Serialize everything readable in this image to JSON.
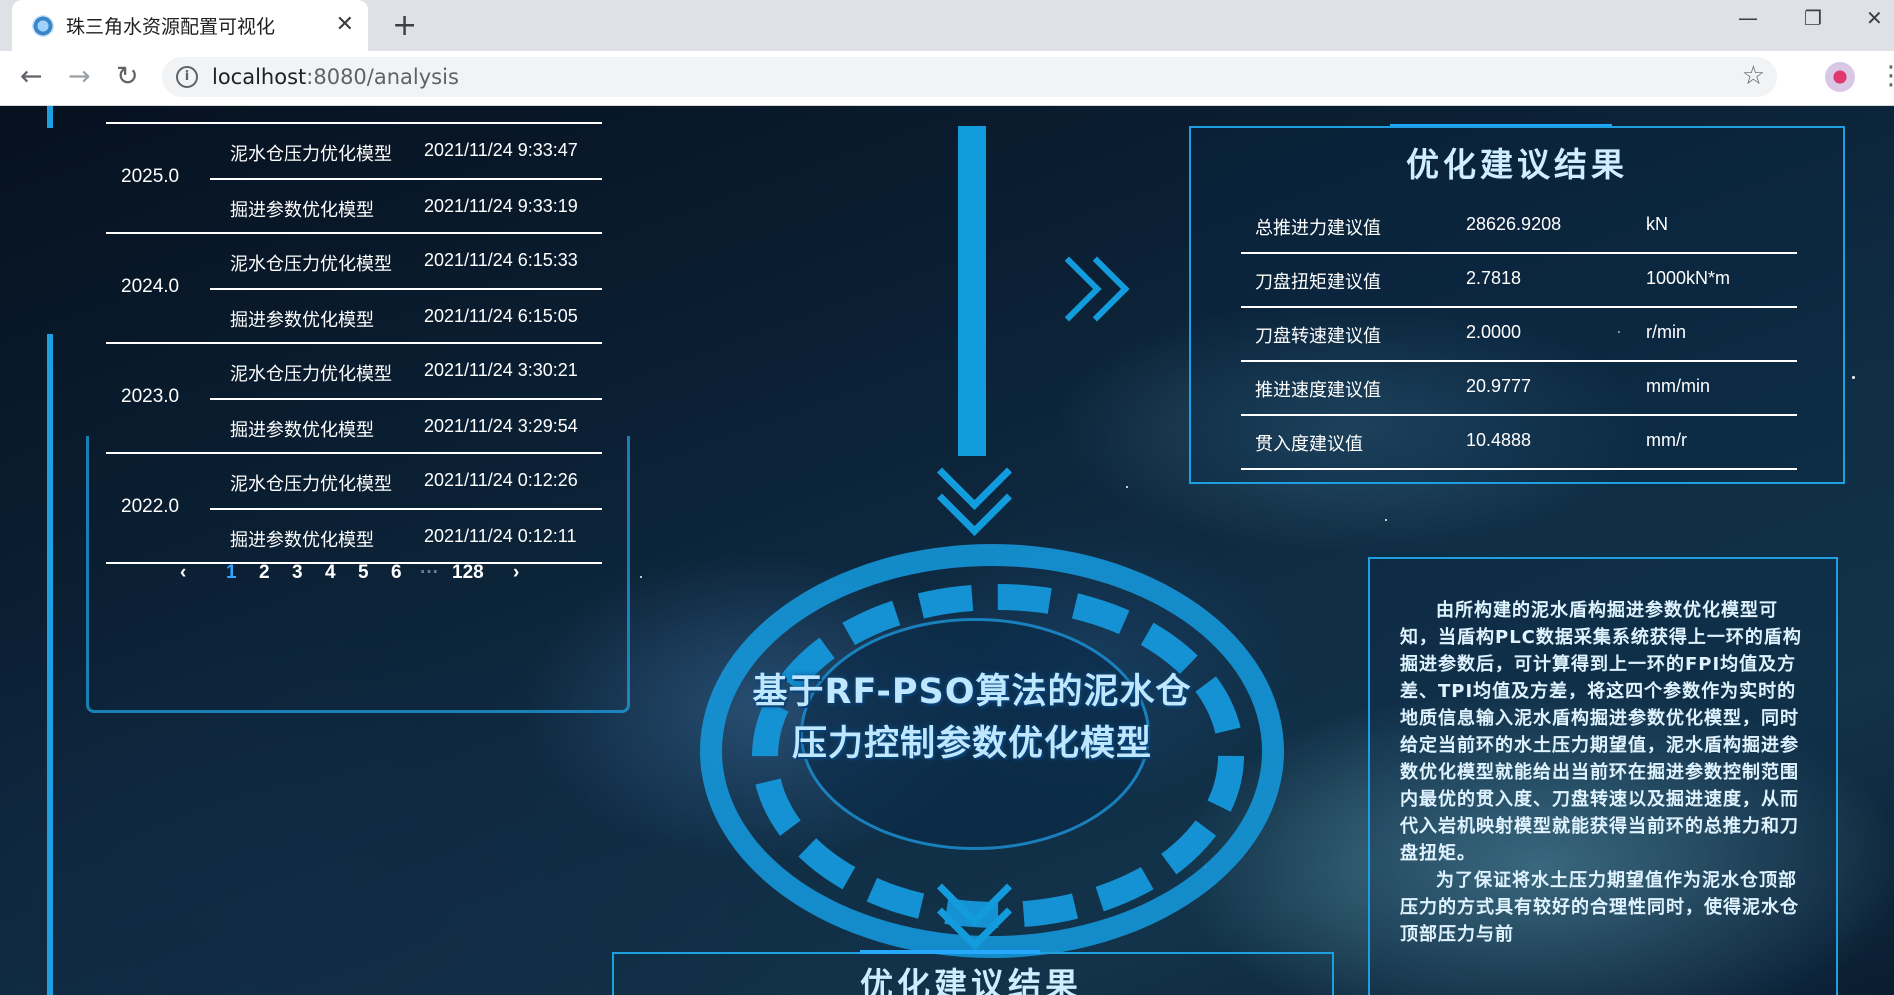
{
  "browser": {
    "tab_title": "珠三角水资源配置可视化",
    "close_glyph": "✕",
    "new_tab_glyph": "+",
    "minimize_glyph": "—",
    "maximize_glyph": "❐",
    "window_close_glyph": "✕",
    "url_host": "localhost",
    "url_rest": ":8080/analysis",
    "back_glyph": "←",
    "forward_glyph": "→",
    "reload_glyph": "↻",
    "star_glyph": "☆",
    "info_glyph": "i",
    "menu_glyph": "⋮"
  },
  "history": {
    "groups": [
      {
        "year": "2025.0",
        "rows": [
          {
            "name": "泥水仓压力优化模型",
            "time": "2021/11/24 9:33:47"
          },
          {
            "name": "掘进参数优化模型",
            "time": "2021/11/24 9:33:19"
          }
        ]
      },
      {
        "year": "2024.0",
        "rows": [
          {
            "name": "泥水仓压力优化模型",
            "time": "2021/11/24 6:15:33"
          },
          {
            "name": "掘进参数优化模型",
            "time": "2021/11/24 6:15:05"
          }
        ]
      },
      {
        "year": "2023.0",
        "rows": [
          {
            "name": "泥水仓压力优化模型",
            "time": "2021/11/24 3:30:21"
          },
          {
            "name": "掘进参数优化模型",
            "time": "2021/11/24 3:29:54"
          }
        ]
      },
      {
        "year": "2022.0",
        "rows": [
          {
            "name": "泥水仓压力优化模型",
            "time": "2021/11/24 0:12:26"
          },
          {
            "name": "掘进参数优化模型",
            "time": "2021/11/24 0:12:11"
          }
        ]
      }
    ]
  },
  "pager": {
    "prev": "‹",
    "pages": [
      "1",
      "2",
      "3",
      "4",
      "5",
      "6"
    ],
    "ellipsis": "···",
    "last": "128",
    "next": "›",
    "current": "1"
  },
  "model": {
    "title_line1": "基于RF-PSO算法的泥水仓",
    "title_line2": "压力控制参数优化模型"
  },
  "result": {
    "title": "优化建议结果",
    "rows": [
      {
        "name": "总推进力建议值",
        "value": "28626.9208",
        "unit": "kN"
      },
      {
        "name": "刀盘扭矩建议值",
        "value": "2.7818",
        "unit": "1000kN*m"
      },
      {
        "name": "刀盘转速建议值",
        "value": "2.0000",
        "unit": "r/min"
      },
      {
        "name": "推进速度建议值",
        "value": "20.9777",
        "unit": "mm/min"
      },
      {
        "name": "贯入度建议值",
        "value": "10.4888",
        "unit": "mm/r"
      }
    ]
  },
  "bottom_title": "优化建议结果",
  "description": {
    "p1": "由所构建的泥水盾构掘进参数优化模型可知，当盾构PLC数据采集系统获得上一环的盾构掘进参数后，可计算得到上一环的FPI均值及方差、TPI均值及方差，将这四个参数作为实时的地质信息输入泥水盾构掘进参数优化模型，同时给定当前环的水土压力期望值，泥水盾构掘进参数优化模型就能给出当前环在掘进参数控制范围内最优的贯入度、刀盘转速以及掘进速度，从而代入岩机映射模型就能获得当前环的总推力和刀盘扭矩。",
    "p2": "为了保证将水土压力期望值作为泥水仓顶部压力的方式具有较好的合理性同时，使得泥水仓顶部压力与前"
  },
  "colors": {
    "accent": "#139cdd",
    "frame": "#1e9fe0",
    "active_page": "#35a4ff"
  }
}
